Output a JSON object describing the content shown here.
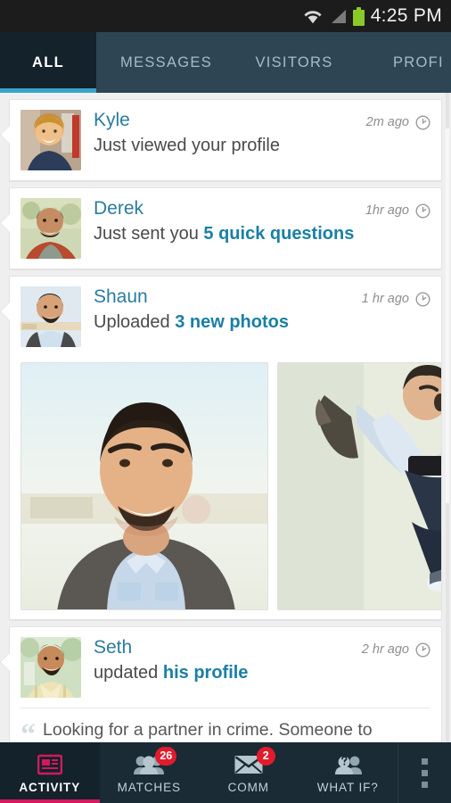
{
  "statusbar": {
    "time": "4:25 PM",
    "wifi_icon": "wifi-icon",
    "signal_icon": "signal-icon",
    "battery_icon": "battery-icon"
  },
  "tabs": [
    {
      "label": "ALL",
      "active": true
    },
    {
      "label": "MESSAGES",
      "active": false
    },
    {
      "label": "VISITORS",
      "active": false
    },
    {
      "label": "PROFI",
      "active": false
    }
  ],
  "feed": [
    {
      "name": "Kyle",
      "action_prefix": "Just viewed your profile",
      "action_link": "",
      "timestamp": "2m ago",
      "clock_icon": "clock-icon"
    },
    {
      "name": "Derek",
      "action_prefix": "Just sent you ",
      "action_link": "5 quick questions",
      "timestamp": "1hr ago",
      "clock_icon": "clock-icon"
    },
    {
      "name": "Shaun",
      "action_prefix": "Uploaded ",
      "action_link": "3 new photos",
      "timestamp": "1 hr ago",
      "clock_icon": "clock-icon",
      "photos": [
        {
          "alt": "man-smiling-portrait-photo"
        },
        {
          "alt": "man-jumping-photo"
        }
      ]
    },
    {
      "name": "Seth",
      "action_prefix": "updated ",
      "action_link": "his profile",
      "timestamp": "2 hr ago",
      "clock_icon": "clock-icon",
      "quote": "Looking for a partner in crime. Someone to",
      "quote_mark": "“"
    }
  ],
  "bottomnav": {
    "items": [
      {
        "label": "ACTIVITY",
        "icon": "activity-icon",
        "badge": "",
        "active": true
      },
      {
        "label": "MATCHES",
        "icon": "people-icon",
        "badge": "26",
        "active": false
      },
      {
        "label": "COMM",
        "icon": "envelope-icon",
        "badge": "2",
        "active": false
      },
      {
        "label": "WHAT IF?",
        "icon": "question-person-icon",
        "badge": "",
        "active": false
      }
    ],
    "overflow_icon": "overflow-menu-icon"
  },
  "colors": {
    "accent_teal": "#2b7c9e",
    "link_teal": "#1a7fa5",
    "tab_active_underline": "#3ba3c7",
    "tabbar_bg": "#2e4653",
    "tab_active_bg": "#13222b",
    "nav_bg": "#1a2b35",
    "nav_active_accent": "#d2195e",
    "badge_red": "#e21b2c",
    "battery_green": "#8bc926",
    "page_bg": "#efefef"
  }
}
